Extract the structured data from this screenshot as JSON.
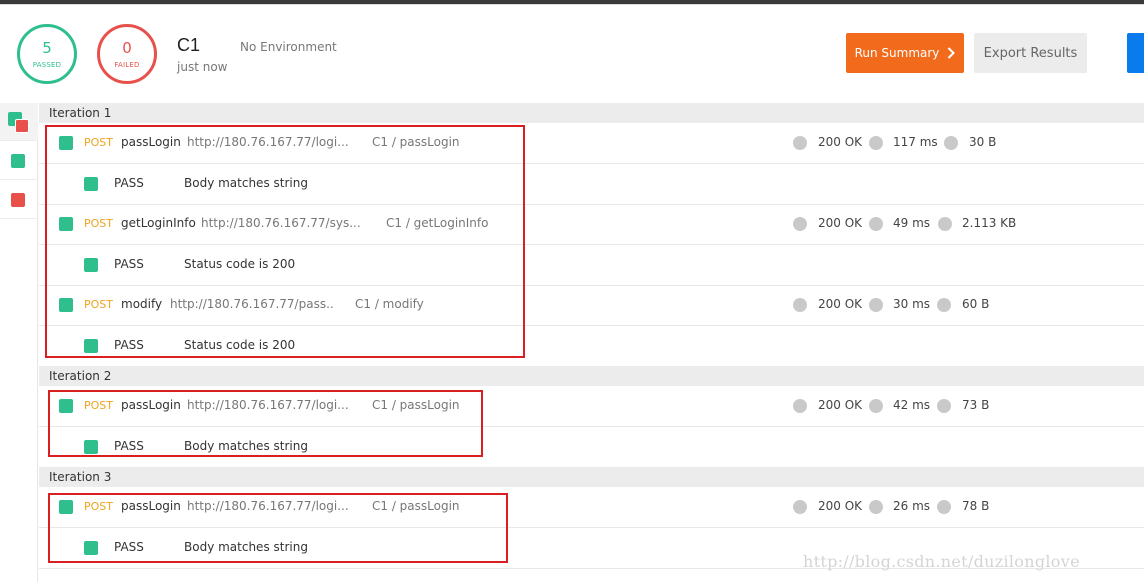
{
  "summary": {
    "passed_count": "5",
    "passed_label": "PASSED",
    "failed_count": "0",
    "failed_label": "FAILED",
    "run_name": "C1",
    "run_time": "just now",
    "environment": "No Environment",
    "run_summary_label": "Run Summary",
    "export_label": "Export Results"
  },
  "colors": {
    "pass": "#2fbf8d",
    "fail": "#e8514b",
    "accent": "#f26b1d",
    "method": "#f0a31c"
  },
  "iterations": [
    {
      "title": "Iteration 1",
      "requests": [
        {
          "method": "POST",
          "name": "passLogin",
          "url": "http://180.76.167.77/logi...",
          "path": "C1 / passLogin",
          "status": "200 OK",
          "time": "117 ms",
          "size": "30 B",
          "test": {
            "result": "PASS",
            "name": "Body matches string"
          }
        },
        {
          "method": "POST",
          "name": "getLoginInfo",
          "url": "http://180.76.167.77/sys...",
          "path": "C1 / getLoginInfo",
          "status": "200 OK",
          "time": "49 ms",
          "size": "2.113 KB",
          "test": {
            "result": "PASS",
            "name": "Status code is 200"
          }
        },
        {
          "method": "POST",
          "name": "modify",
          "url": "http://180.76.167.77/pass..",
          "path": "C1 / modify",
          "status": "200 OK",
          "time": "30 ms",
          "size": "60 B",
          "test": {
            "result": "PASS",
            "name": "Status code is 200"
          }
        }
      ]
    },
    {
      "title": "Iteration 2",
      "requests": [
        {
          "method": "POST",
          "name": "passLogin",
          "url": "http://180.76.167.77/logi...",
          "path": "C1 / passLogin",
          "status": "200 OK",
          "time": "42 ms",
          "size": "73 B",
          "test": {
            "result": "PASS",
            "name": "Body matches string"
          }
        }
      ]
    },
    {
      "title": "Iteration 3",
      "requests": [
        {
          "method": "POST",
          "name": "passLogin",
          "url": "http://180.76.167.77/logi...",
          "path": "C1 / passLogin",
          "status": "200 OK",
          "time": "26 ms",
          "size": "78 B",
          "test": {
            "result": "PASS",
            "name": "Body matches string"
          }
        }
      ]
    }
  ],
  "watermark": "http://blog.csdn.net/duzilonglove"
}
